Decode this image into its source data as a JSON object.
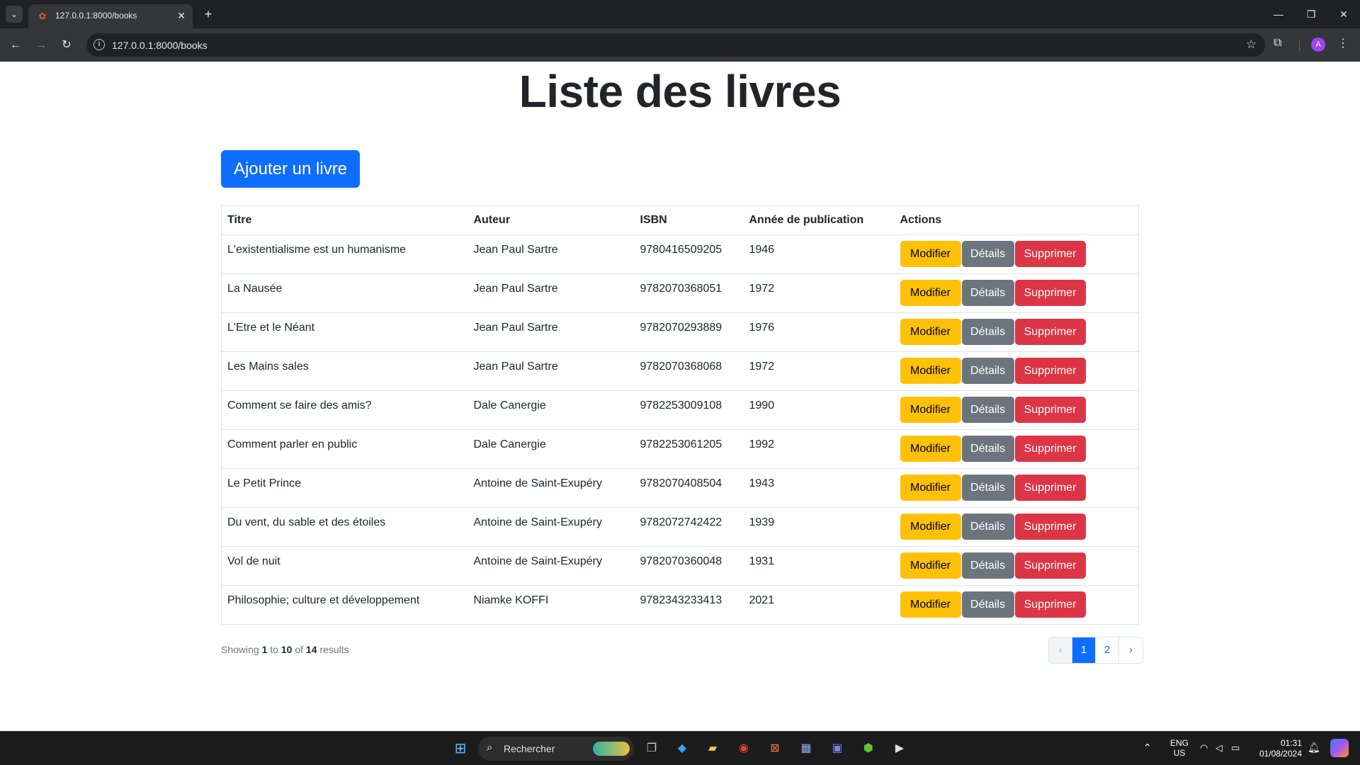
{
  "browser": {
    "tab_title": "127.0.0.1:8000/books",
    "url": "127.0.0.1:8000/books",
    "profile_initial": "A"
  },
  "page": {
    "title": "Liste des livres",
    "add_button": "Ajouter un livre",
    "columns": [
      "Titre",
      "Auteur",
      "ISBN",
      "Année de publication",
      "Actions"
    ],
    "books": [
      {
        "title": "L'existentialisme est un humanisme",
        "author": "Jean Paul Sartre",
        "isbn": "9780416509205",
        "year": "1946"
      },
      {
        "title": "La Nausée",
        "author": "Jean Paul Sartre",
        "isbn": "9782070368051",
        "year": "1972"
      },
      {
        "title": "L'Etre et le Néant",
        "author": "Jean Paul Sartre",
        "isbn": "9782070293889",
        "year": "1976"
      },
      {
        "title": "Les Mains sales",
        "author": "Jean Paul Sartre",
        "isbn": "9782070368068",
        "year": "1972"
      },
      {
        "title": "Comment se faire des amis?",
        "author": "Dale Canergie",
        "isbn": "9782253009108",
        "year": "1990"
      },
      {
        "title": "Comment parler en public",
        "author": "Dale Canergie",
        "isbn": "9782253061205",
        "year": "1992"
      },
      {
        "title": "Le Petit Prince",
        "author": "Antoine de Saint-Exupéry",
        "isbn": "9782070408504",
        "year": "1943"
      },
      {
        "title": "Du vent, du sable et des étoiles",
        "author": "Antoine de Saint-Exupéry",
        "isbn": "9782072742422",
        "year": "1939"
      },
      {
        "title": "Vol de nuit",
        "author": "Antoine de Saint-Exupéry",
        "isbn": "9782070360048",
        "year": "1931"
      },
      {
        "title": "Philosophie; culture et développement",
        "author": "Niamke KOFFI",
        "isbn": "9782343233413",
        "year": "2021"
      }
    ],
    "actions": {
      "edit": "Modifier",
      "details": "Détails",
      "delete": "Supprimer"
    },
    "pagination": {
      "showing": "Showing",
      "from": "1",
      "to_word": "to",
      "to": "10",
      "of_word": "of",
      "total": "14",
      "results_word": "results",
      "prev": "‹",
      "pages": [
        "1",
        "2"
      ],
      "current": "1",
      "next": "›"
    }
  },
  "taskbar": {
    "search_placeholder": "Rechercher",
    "lang": "ENG",
    "region": "US",
    "time": "01:31",
    "date": "01/08/2024"
  },
  "colors": {
    "primary": "#0d6efd",
    "warning": "#ffc107",
    "secondary": "#6c757d",
    "danger": "#dc3545"
  }
}
